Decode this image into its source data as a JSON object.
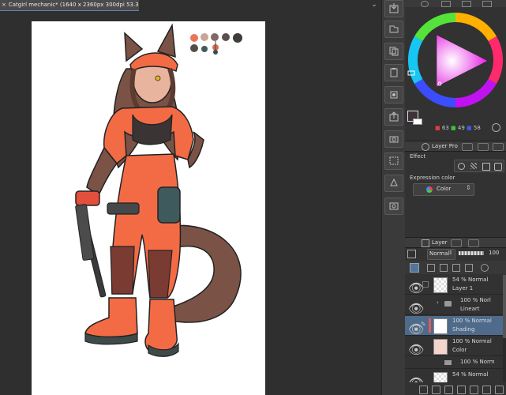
{
  "document_tab": {
    "title": "Catgirl mechanic* (1640 x 2360px 300dpi 53.3%)",
    "close_glyph": "×",
    "menu_glyph": "⌄"
  },
  "palette_swatches": [
    "#e9765a",
    "#c9a598",
    "#7d6a64",
    "#5b504e",
    "#3f3c3b",
    "#524d4c",
    "#435b5c",
    "#d76e57",
    "#3d4a4a",
    "#4f4d4c"
  ],
  "command_bar": {
    "icons": [
      "import-icon",
      "new-layer-folder-icon",
      "copy-icon",
      "paste-icon",
      "transform-icon",
      "export-icon",
      "camera-icon",
      "selection-icon",
      "fill-icon",
      "snapshot-icon",
      "image-icon"
    ]
  },
  "color_wheel": {
    "rgb": {
      "r": "63",
      "g": "49",
      "b": "58"
    },
    "current_color": "#3f313a",
    "secondary_color": "#ffffff"
  },
  "layer_property": {
    "tab_label": "Layer Pro",
    "effect_label": "Effect",
    "expression_color_label": "Expression color",
    "expression_value": "Color"
  },
  "layer_panel": {
    "tab_label": "Layer",
    "blend_mode": "Normal",
    "opacity": "100",
    "layers": [
      {
        "top": "54 % Normal",
        "name": "Layer 1",
        "selected": false,
        "type": "raster"
      },
      {
        "top": "100 % Norl",
        "name": "Lineart",
        "selected": false,
        "type": "folder"
      },
      {
        "top": "100 % Normal",
        "name": "Shading",
        "selected": true,
        "type": "raster"
      },
      {
        "top": "100 % Normal",
        "name": "Color",
        "selected": false,
        "type": "raster"
      },
      {
        "top": "100 % Norm",
        "name": "",
        "selected": false,
        "type": "folder"
      },
      {
        "top": "54 % Normal",
        "name": "",
        "selected": false,
        "type": "raster"
      }
    ]
  },
  "colors": {
    "selection": "#4f6b8c",
    "tab_accent": "#5d86b8",
    "character_orange": "#f36b45",
    "character_brown": "#7a5346"
  }
}
